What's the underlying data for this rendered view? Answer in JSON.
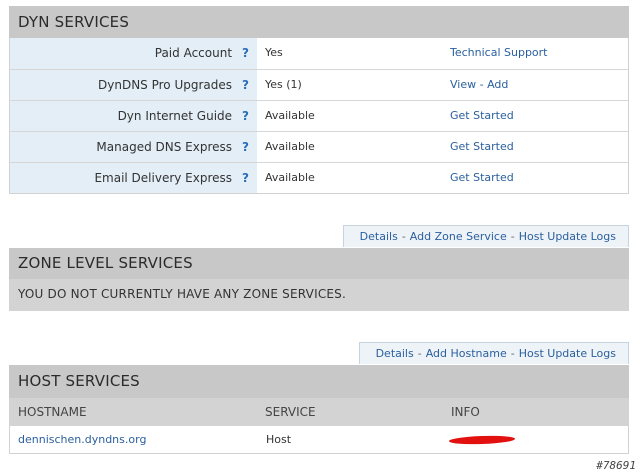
{
  "dyn": {
    "title": "DYN SERVICES",
    "help_glyph": "?",
    "rows": [
      {
        "name": "Paid Account",
        "value": "Yes",
        "link": "Technical Support"
      },
      {
        "name": "DynDNS Pro Upgrades",
        "value": "Yes (1)",
        "link": "View - Add"
      },
      {
        "name": "Dyn Internet Guide",
        "value": "Available",
        "link": "Get Started"
      },
      {
        "name": "Managed DNS Express",
        "value": "Available",
        "link": "Get Started"
      },
      {
        "name": "Email Delivery Express",
        "value": "Available",
        "link": "Get Started"
      }
    ]
  },
  "zone_tabs": {
    "details": "Details",
    "add": "Add Zone Service",
    "logs": "Host Update Logs",
    "sep": "-"
  },
  "zone": {
    "title": "ZONE LEVEL SERVICES",
    "message": "YOU DO NOT CURRENTLY HAVE ANY ZONE SERVICES."
  },
  "host_tabs": {
    "details": "Details",
    "add": "Add Hostname",
    "logs": "Host Update Logs",
    "sep": "-"
  },
  "host": {
    "title": "HOST SERVICES",
    "columns": {
      "hostname": "HOSTNAME",
      "service": "SERVICE",
      "info": "INFO"
    },
    "rows": [
      {
        "hostname": "dennischen.dyndns.org",
        "service": "Host"
      }
    ],
    "redaction_color": "#e31010"
  },
  "watermark": "#78691",
  "colors": {
    "link": "#2a5f9e",
    "help": "#2a6fb8",
    "header_bg": "#c8c8c8",
    "name_bg": "#e3eef7"
  }
}
